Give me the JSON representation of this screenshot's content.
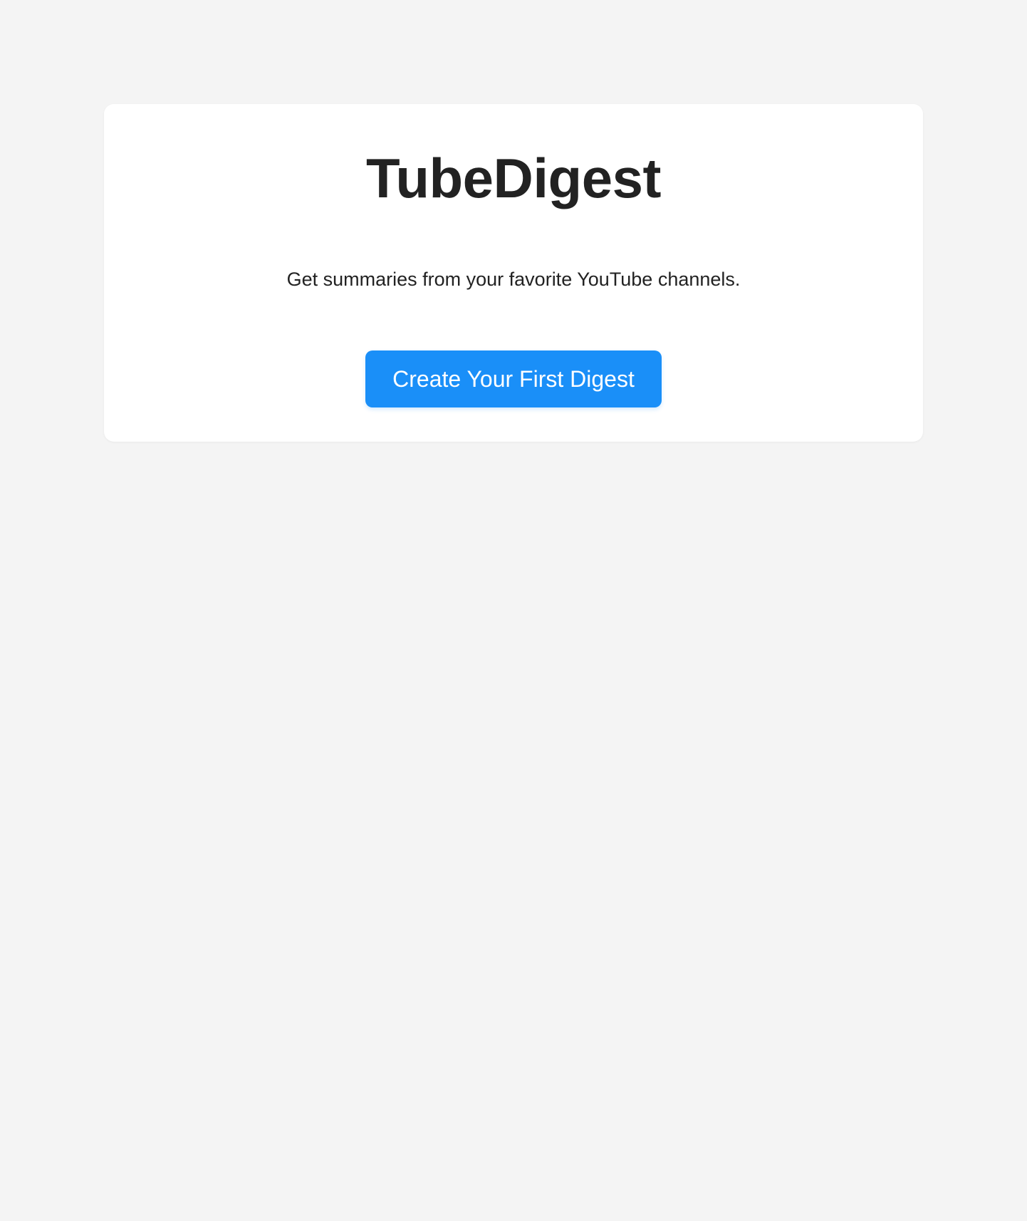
{
  "app": {
    "title": "TubeDigest",
    "subtitle": "Get summaries from your favorite YouTube channels."
  },
  "actions": {
    "primary_label": "Create Your First Digest"
  },
  "colors": {
    "background": "#f4f4f4",
    "card": "#ffffff",
    "text": "#222222",
    "accent": "#1a8ff8"
  }
}
